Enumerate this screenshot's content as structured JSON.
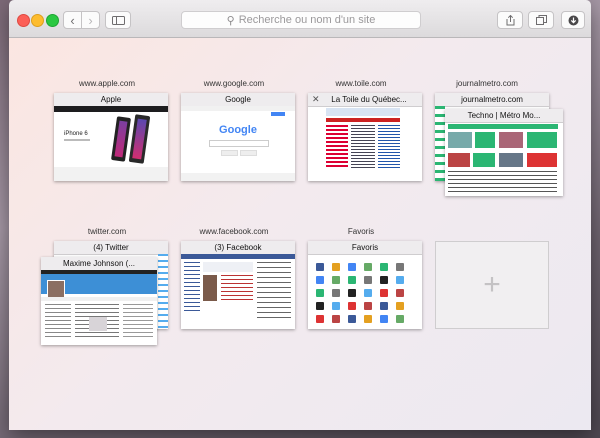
{
  "toolbar": {
    "address_placeholder": "Recherche ou nom d'un site",
    "back_icon": "‹",
    "forward_icon": "›",
    "sidebar_icon": "▭",
    "share_icon": "⇧",
    "tabs_icon": "⧉",
    "download_icon": "⬇"
  },
  "top_sites": [
    {
      "domain": "www.apple.com",
      "title": "Apple"
    },
    {
      "domain": "www.google.com",
      "title": "Google"
    },
    {
      "domain": "www.toile.com",
      "title": "La Toile du Québec..."
    },
    {
      "domain": "journalmetro.com",
      "title": "journalmetro.com",
      "front_title": "Techno | Métro Mo..."
    },
    {
      "domain": "twitter.com",
      "title": "(4) Twitter",
      "front_title": "Maxime Johnson (..."
    },
    {
      "domain": "www.facebook.com",
      "title": "(3) Facebook"
    },
    {
      "domain": "Favoris",
      "title": "Favoris"
    }
  ],
  "add_site": {
    "symbol": "+"
  },
  "colors": {
    "close": "#fc5f57",
    "minimize": "#fdbc2e",
    "maximize": "#2ac841",
    "twitter": "#55acee",
    "facebook": "#3b5998",
    "google_blue": "#4285f4",
    "metro_green": "#2bb673"
  },
  "thumbnails": {
    "apple": {
      "product": "iPhone 6"
    },
    "google": {
      "logo": "Google"
    }
  }
}
